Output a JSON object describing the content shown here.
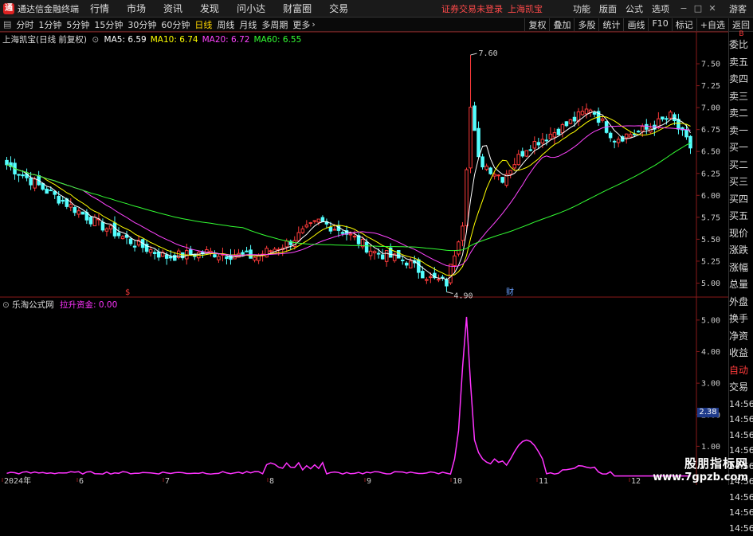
{
  "titlebar": {
    "app_title": "通达信金融终端",
    "menu": [
      "行情",
      "市场",
      "资讯",
      "发现",
      "问小达",
      "财富圈",
      "交易"
    ],
    "notice": "证券交易未登录",
    "notice_stock": "上海凯宝",
    "right_menu": [
      "功能",
      "版面",
      "公式",
      "选项"
    ],
    "guest": "游客"
  },
  "toolbar": {
    "periods": [
      "分时",
      "1分钟",
      "5分钟",
      "15分钟",
      "30分钟",
      "60分钟",
      "日线",
      "周线",
      "月线",
      "多周期",
      "更多"
    ],
    "active_period": "日线",
    "right_buttons": [
      "复权",
      "叠加",
      "多股",
      "统计",
      "画线",
      "F10",
      "标记",
      "+自选",
      "返回"
    ]
  },
  "main_chart": {
    "stock_title": "上海凯宝(日线 前复权)",
    "ma": [
      {
        "label": "MA5:",
        "value": "6.59",
        "color": "#ffffff"
      },
      {
        "label": "MA10:",
        "value": "6.74",
        "color": "#ffff00"
      },
      {
        "label": "MA20:",
        "value": "6.72",
        "color": "#ff44ff"
      },
      {
        "label": "MA60:",
        "value": "6.55",
        "color": "#33ff33"
      }
    ],
    "high_label": "7.60",
    "low_label": "4.90",
    "markers": [
      {
        "text": "$",
        "color": "#ff3b3b"
      },
      {
        "text": "财",
        "color": "#6aa0ff"
      }
    ],
    "yticks": [
      "7.50",
      "7.25",
      "7.00",
      "6.75",
      "6.50",
      "6.25",
      "6.00",
      "5.75",
      "5.50",
      "5.25",
      "5.00"
    ]
  },
  "indicator": {
    "formula_name": "乐淘公式网",
    "line_label": "拉升资金:",
    "line_value": "0.00",
    "line_color": "#ff33ff",
    "yticks": [
      "5.00",
      "4.00",
      "3.00",
      "2.00",
      "1.00"
    ],
    "cursor_value": "2.38"
  },
  "xaxis": {
    "labels": [
      "2024年",
      "6",
      "7",
      "8",
      "9",
      "10",
      "11",
      "12"
    ]
  },
  "right_panel": {
    "top": "B",
    "items": [
      "委比",
      "卖五",
      "卖四",
      "卖三",
      "卖二",
      "卖一",
      "买一",
      "买二",
      "买三",
      "买四",
      "买五",
      "现价",
      "涨跌",
      "涨幅",
      "总量",
      "外盘",
      "换手",
      "净资",
      "收益"
    ],
    "auto_label": "自动",
    "trade_label": "交易",
    "times": [
      "14:56",
      "14:56",
      "14:56",
      "14:56",
      "14:56",
      "14:56",
      "14:56",
      "14:56",
      "14:56"
    ]
  },
  "watermark": {
    "line1": "股朋指标网",
    "line2": "www.7gpzb.com"
  },
  "chart_data": {
    "type": "candlestick",
    "candles_approx": {
      "description_points": [
        {
          "x": "2024-05",
          "close": 6.35
        },
        {
          "x": "2024-06",
          "close": 5.65
        },
        {
          "x": "2024-07",
          "close": 5.35
        },
        {
          "x": "2024-08",
          "close": 5.55
        },
        {
          "x": "2024-09",
          "close": 5.0
        },
        {
          "x": "2024-10",
          "close": 6.2
        },
        {
          "x": "2024-11",
          "close": 6.95
        },
        {
          "x": "2024-12",
          "close": 6.6
        }
      ],
      "high": 7.6,
      "low": 4.9
    },
    "ylim": [
      4.85,
      7.7
    ],
    "indicator_series": {
      "name": "拉升资金",
      "peak": 5.1,
      "ylim": [
        0,
        5.3
      ]
    }
  }
}
